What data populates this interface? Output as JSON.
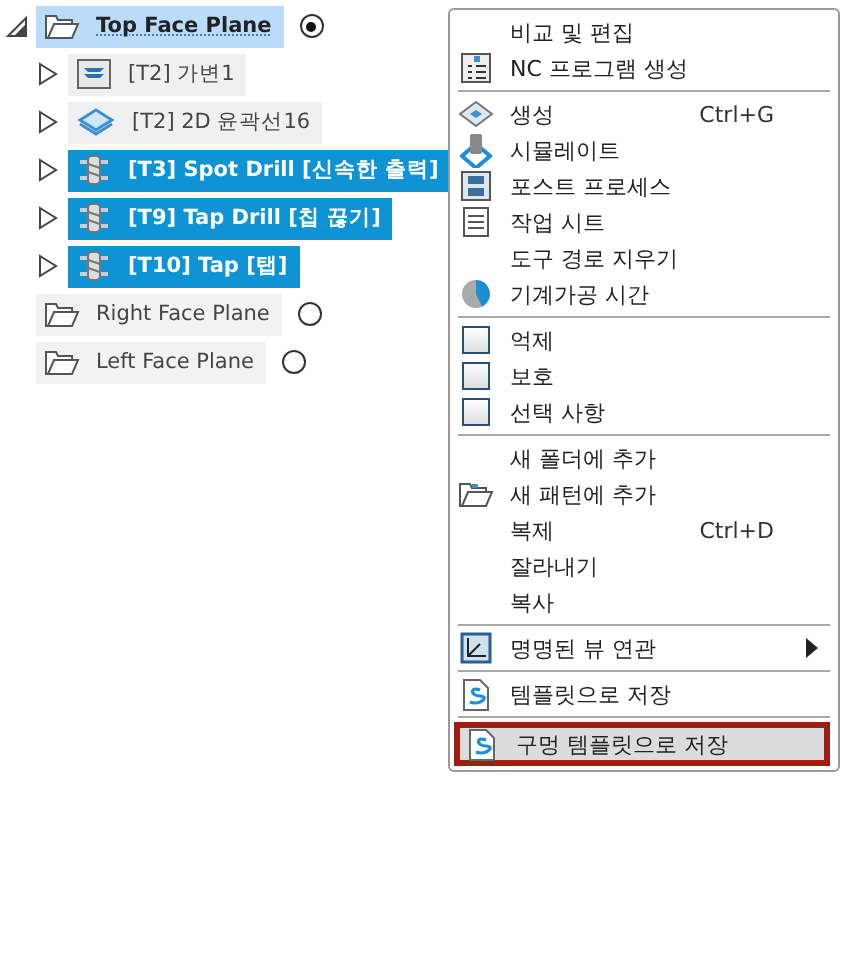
{
  "tree": [
    {
      "label": "Top Face Plane",
      "kind": "plane",
      "expanded": true,
      "highlighted": true,
      "active": true,
      "children": [
        {
          "label": "[T2] 가변1",
          "kind": "adaptive",
          "expanded": false,
          "selected": false
        },
        {
          "label": "[T2] 2D 윤곽선16",
          "kind": "contour",
          "expanded": false,
          "selected": false
        },
        {
          "label": "[T3] Spot Drill [신속한 출력]",
          "kind": "drill",
          "expanded": false,
          "selected": true
        },
        {
          "label": "[T9] Tap Drill [칩 끊기]",
          "kind": "drill",
          "expanded": false,
          "selected": true
        },
        {
          "label": "[T10] Tap [탭]",
          "kind": "drill",
          "expanded": false,
          "selected": true
        }
      ]
    },
    {
      "label": "Right Face Plane",
      "kind": "plane",
      "highlighted": false,
      "active": false
    },
    {
      "label": "Left Face Plane",
      "kind": "plane",
      "highlighted": false,
      "active": false
    }
  ],
  "menu": {
    "sections": [
      {
        "items": [
          {
            "label": "비교 및 편집",
            "kind": "text",
            "selected": false
          },
          {
            "label": "NC 프로그램 생성",
            "kind": "nc",
            "selected": false
          }
        ]
      },
      {
        "items": [
          {
            "label": "생성",
            "kind": "generate",
            "shortcut": "Ctrl+G",
            "selected": false
          },
          {
            "label": "시뮬레이트",
            "kind": "simulate",
            "selected": false
          },
          {
            "label": "포스트 프로세스",
            "kind": "post",
            "selected": false
          },
          {
            "label": "작업 시트",
            "kind": "sheet",
            "selected": false
          },
          {
            "label": "도구 경로 지우기",
            "kind": "text",
            "selected": false
          },
          {
            "label": "기계가공 시간",
            "kind": "time",
            "selected": false
          }
        ]
      },
      {
        "items": [
          {
            "label": "억제",
            "kind": "checkbox",
            "checked": false,
            "selected": false
          },
          {
            "label": "보호",
            "kind": "checkbox",
            "checked": false,
            "selected": false
          },
          {
            "label": "선택 사항",
            "kind": "checkbox",
            "checked": false,
            "selected": false
          }
        ]
      },
      {
        "items": [
          {
            "label": "새 폴더에 추가",
            "kind": "text",
            "selected": false
          },
          {
            "label": "새 패턴에 추가",
            "kind": "pattern",
            "selected": false
          },
          {
            "label": "복제",
            "kind": "text",
            "shortcut": "Ctrl+D",
            "selected": false
          },
          {
            "label": "잘라내기",
            "kind": "text",
            "selected": false
          },
          {
            "label": "복사",
            "kind": "text",
            "selected": false
          }
        ]
      },
      {
        "items": [
          {
            "label": "명명된 뷰 연관",
            "kind": "view",
            "submenu": true,
            "selected": false
          }
        ]
      },
      {
        "items": [
          {
            "label": "템플릿으로 저장",
            "kind": "template",
            "selected": false
          }
        ]
      },
      {
        "items": [
          {
            "label": "구멍 템플릿으로 저장",
            "kind": "template",
            "selected": true
          }
        ]
      }
    ]
  }
}
